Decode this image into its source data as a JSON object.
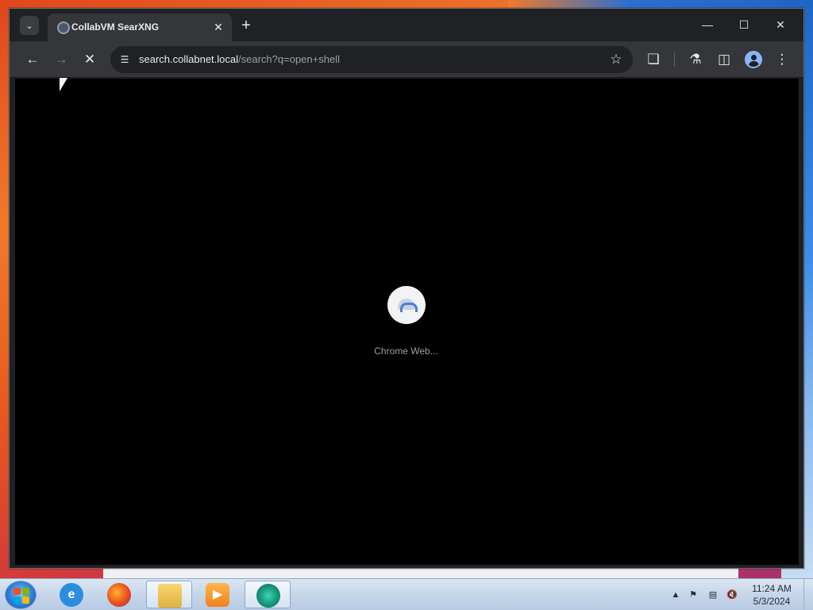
{
  "browser": {
    "tab": {
      "title": "CollabVM SearXNG"
    },
    "address": {
      "host": "search.collabnet.local",
      "path": "/search?q=open+shell"
    },
    "loading": {
      "label": "Chrome Web..."
    }
  },
  "taskbar": {
    "apps": [
      "internet-explorer",
      "firefox",
      "file-explorer",
      "media-player",
      "chrome-web-app"
    ],
    "active_app": "chrome-web-app",
    "clock": {
      "time": "11:24 AM",
      "date": "5/3/2024"
    }
  },
  "colors": {
    "browser_frame": "#202124",
    "toolbar": "#35363a",
    "content_bg": "#000000",
    "taskbar": "#c6d6ea"
  }
}
